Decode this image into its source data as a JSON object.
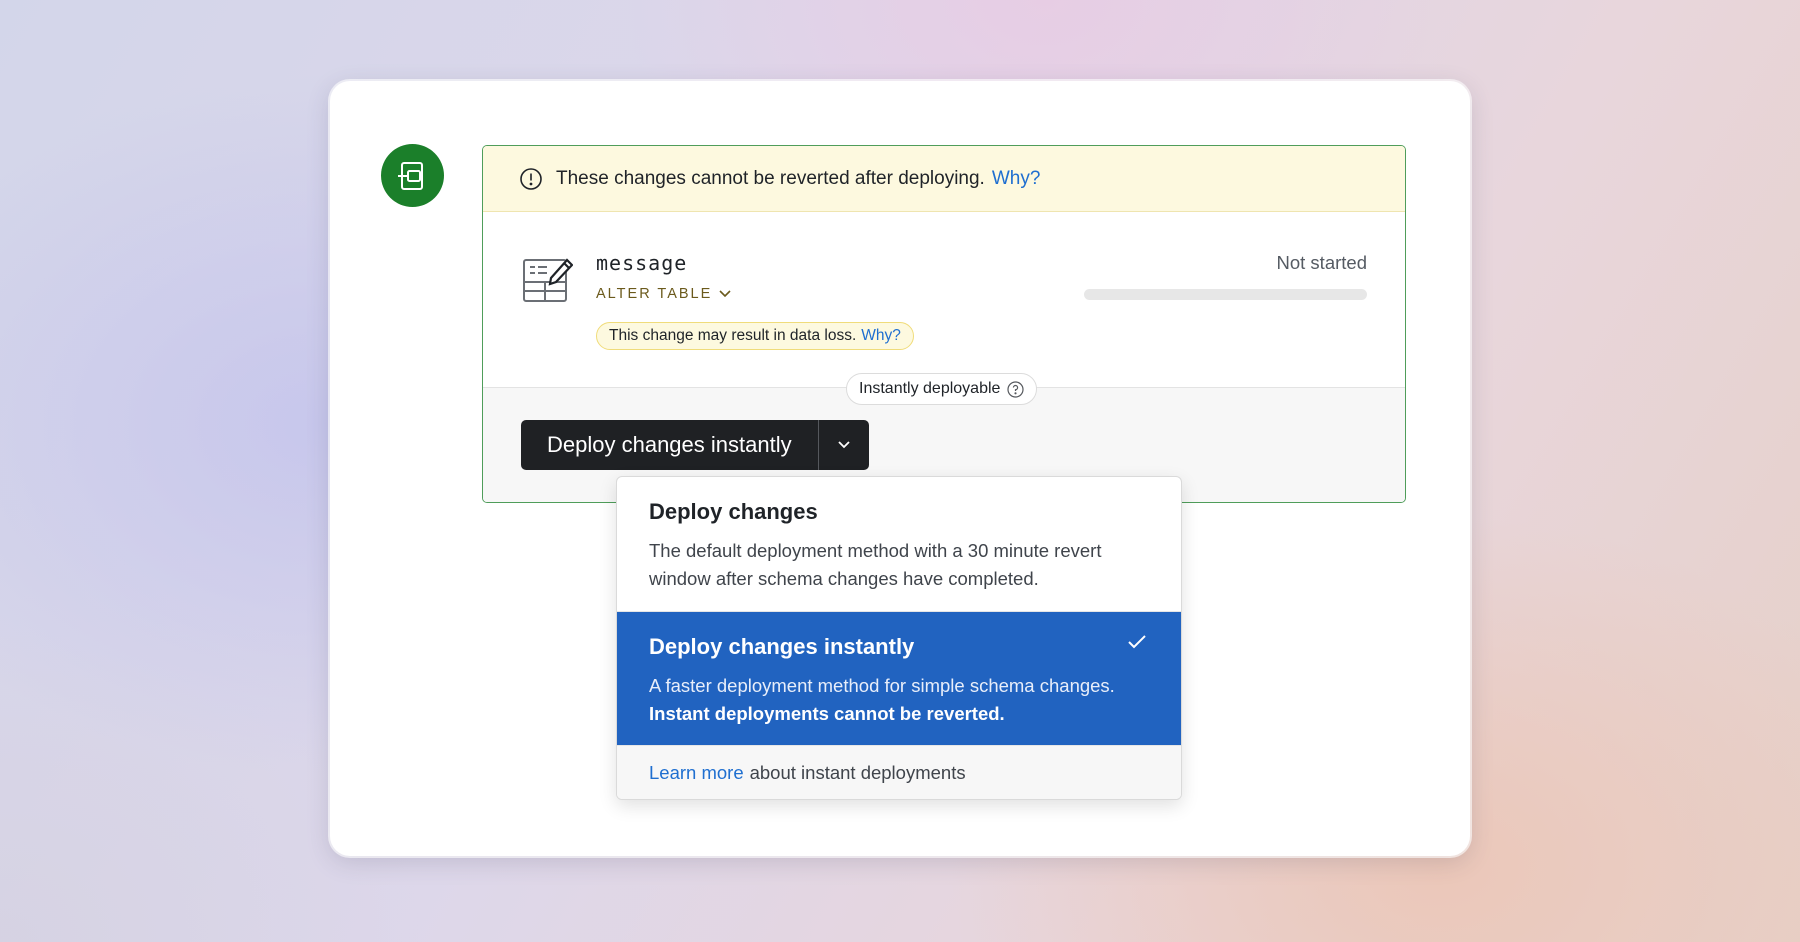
{
  "banner": {
    "text": "These changes cannot be reverted after deploying.",
    "link": "Why?"
  },
  "change": {
    "table_name": "message",
    "operation": "ALTER TABLE",
    "warning_text": "This change may result in data loss.",
    "warning_link": "Why?",
    "status": "Not started",
    "progress": 0
  },
  "deploy": {
    "badge": "Instantly deployable",
    "button_label": "Deploy changes instantly"
  },
  "menu": {
    "options": [
      {
        "title": "Deploy changes",
        "description": "The default deployment method with a 30 minute revert window after schema changes have completed."
      },
      {
        "title": "Deploy changes instantly",
        "description": "A faster deployment method for simple schema changes.",
        "description_strong": "Instant deployments cannot be reverted.",
        "selected": true
      }
    ],
    "footer_link": "Learn more",
    "footer_text": "about instant deployments"
  },
  "colors": {
    "brand_green": "#1b7f2a",
    "selected_blue": "#2163c0",
    "link_blue": "#1f6fd0",
    "warning_bg": "#fdf9df"
  },
  "icons": {
    "avatar": "branch-square-icon",
    "banner": "alert-circle-icon",
    "table": "table-edit-icon",
    "badge": "help-circle-icon",
    "dropdown": "chevron-down-icon",
    "selected": "check-icon"
  }
}
